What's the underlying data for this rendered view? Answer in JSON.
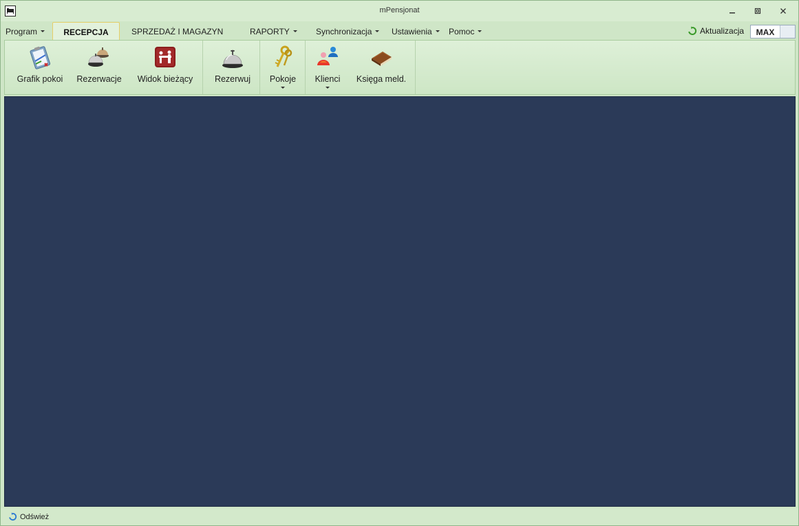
{
  "window": {
    "title": "mPensjonat"
  },
  "menu": {
    "program": "Program",
    "tabs": [
      "RECEPCJA",
      "SPRZEDAŻ I MAGAZYN",
      "RAPORTY"
    ],
    "synchronizacja": "Synchronizacja",
    "ustawienia": "Ustawienia",
    "pomoc": "Pomoc"
  },
  "header": {
    "aktualizacja": "Aktualizacja",
    "max": "MAX"
  },
  "ribbon": {
    "buttons": [
      {
        "label": "Grafik pokoi",
        "icon": "clipboard-schedule-icon"
      },
      {
        "label": "Rezerwacje",
        "icon": "service-bells-icon"
      },
      {
        "label": "Widok bieżący",
        "icon": "reception-desk-icon"
      },
      {
        "label": "Rezerwuj",
        "icon": "service-bell-icon"
      },
      {
        "label": "Pokoje",
        "icon": "keys-icon"
      },
      {
        "label": "Klienci",
        "icon": "people-icon"
      },
      {
        "label": "Księga meld.",
        "icon": "book-icon"
      }
    ]
  },
  "status": {
    "refresh": "Odśwież"
  },
  "colors": {
    "background_main": "#2b3a58",
    "chrome": "#cfe6c7",
    "active_tab_border": "#e6cf6a"
  }
}
